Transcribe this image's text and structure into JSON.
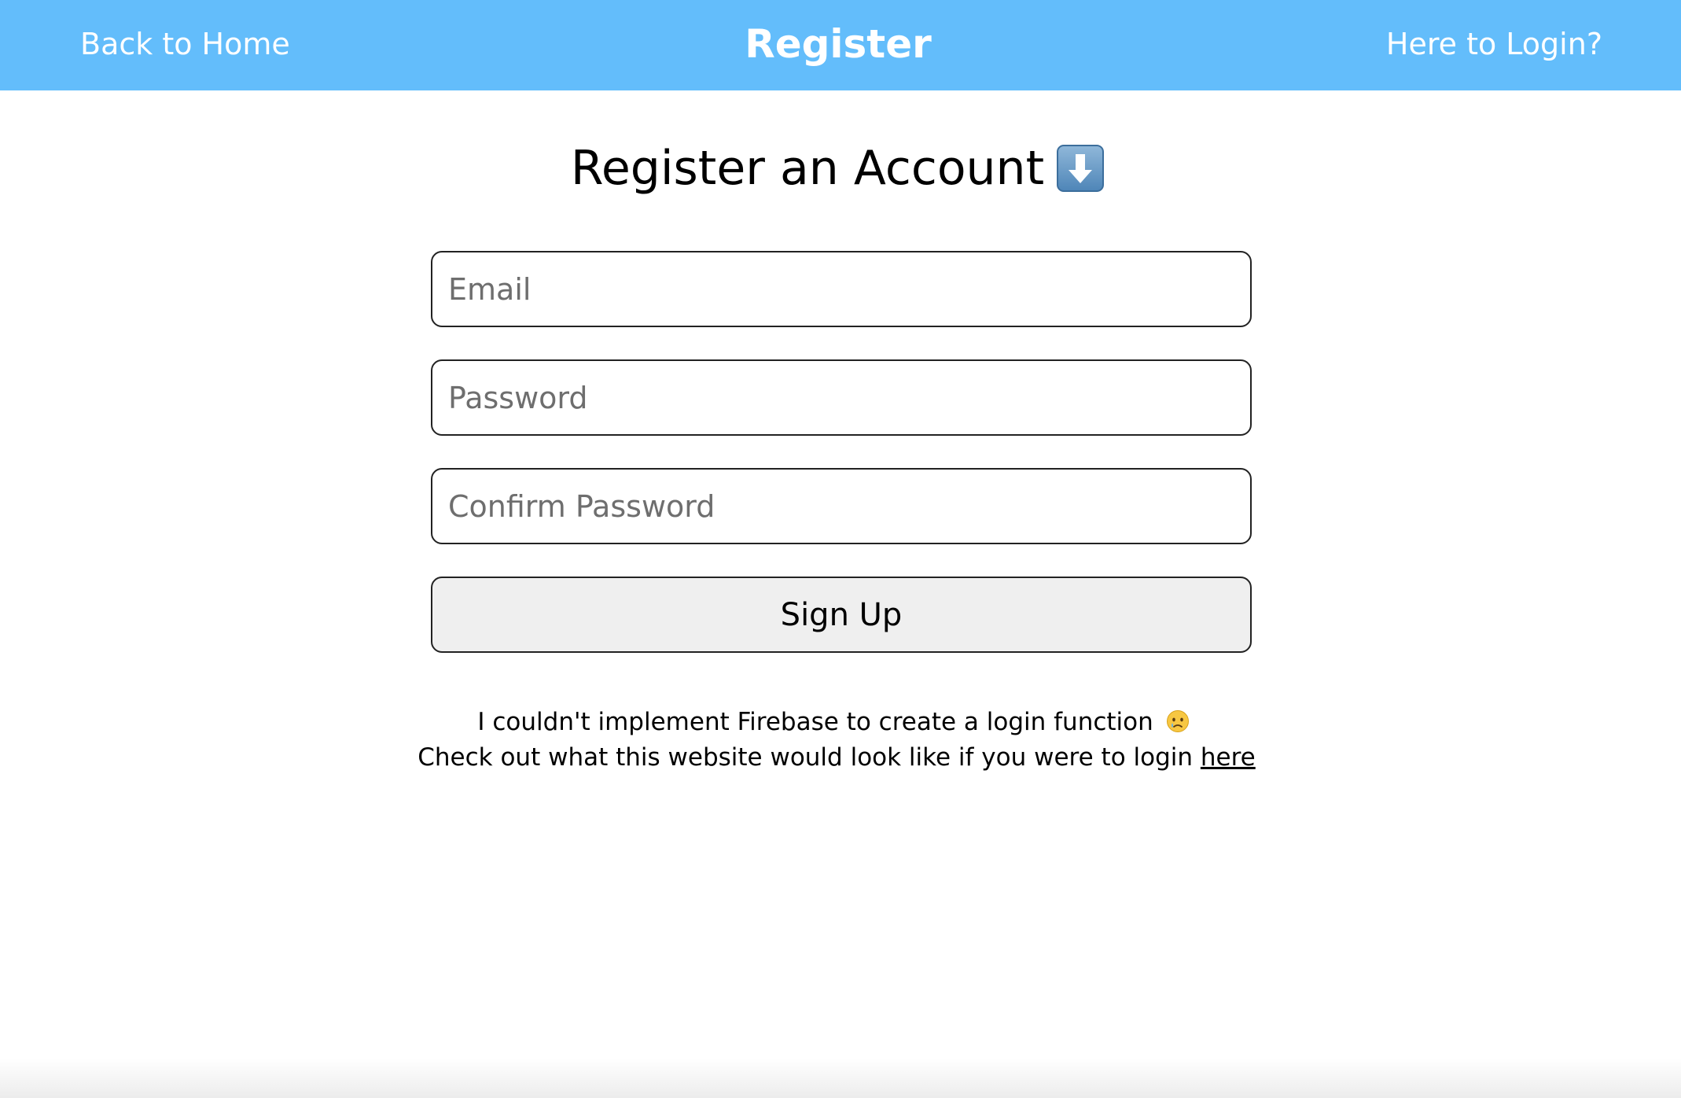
{
  "navbar": {
    "left_link": "Back to Home",
    "title": "Register",
    "right_link": "Here to Login?",
    "background": "#63bdfb"
  },
  "heading": {
    "text": "Register an Account",
    "icon": "down-arrow-icon"
  },
  "form": {
    "email_placeholder": "Email",
    "password_placeholder": "Password",
    "confirm_placeholder": "Confirm Password",
    "submit_label": "Sign Up"
  },
  "note": {
    "line1": "I couldn't implement Firebase to create a login function",
    "line1_icon": "sad-tear-face-icon",
    "line2": "Check out what this website would look like if you were to login",
    "link_text": "here"
  }
}
